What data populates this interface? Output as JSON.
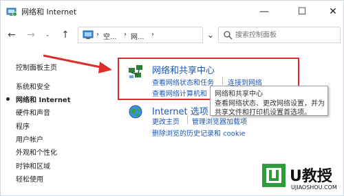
{
  "window": {
    "title": "网络和 Internet",
    "minimize_glyph": "—",
    "maximize_glyph": "☐",
    "close_glyph": "✕"
  },
  "nav": {
    "back_glyph": "←",
    "forward_glyph": "→",
    "recent_glyph": "⌄",
    "up_glyph": "↑",
    "refresh_glyph": "⌄",
    "address": {
      "sep1": "›",
      "seg1": "空...",
      "sep2": "›",
      "seg2": "网...",
      "sep3": "›"
    },
    "search_placeholder": "搜索控制面板"
  },
  "sidebar": {
    "home": "控制面板主页",
    "items": [
      {
        "label": "系统和安全",
        "active": false
      },
      {
        "label": "网络和 Internet",
        "active": true
      },
      {
        "label": "硬件和声音",
        "active": false
      },
      {
        "label": "程序",
        "active": false
      },
      {
        "label": "用户帐户",
        "active": false
      },
      {
        "label": "外观和个性化",
        "active": false
      },
      {
        "label": "时钟和区域",
        "active": false
      },
      {
        "label": "轻松使用",
        "active": false
      }
    ]
  },
  "main": {
    "network_center": {
      "title": "网络和共享中心",
      "link1": "查看网络状态和任务",
      "link2": "连接到网络",
      "link3": "查看网络计算机和"
    },
    "internet_options": {
      "title": "Internet 选项",
      "link1": "更改主页",
      "link2": "管理浏览器加载项",
      "link3": "删除浏览的历史记录和 cookie"
    },
    "tooltip": {
      "title": "网络和共享中心",
      "line1": "查看网络状态、更改网络设置，并为",
      "line2": "共享文件和打印机设置首选项。"
    }
  },
  "watermark": {
    "brand": "U教授",
    "url": "UJIAOSHOU.COM"
  },
  "colors": {
    "accent_link": "#1a56b8",
    "highlight": "#e02b2b",
    "watermark_green": "#2e9b3a"
  }
}
